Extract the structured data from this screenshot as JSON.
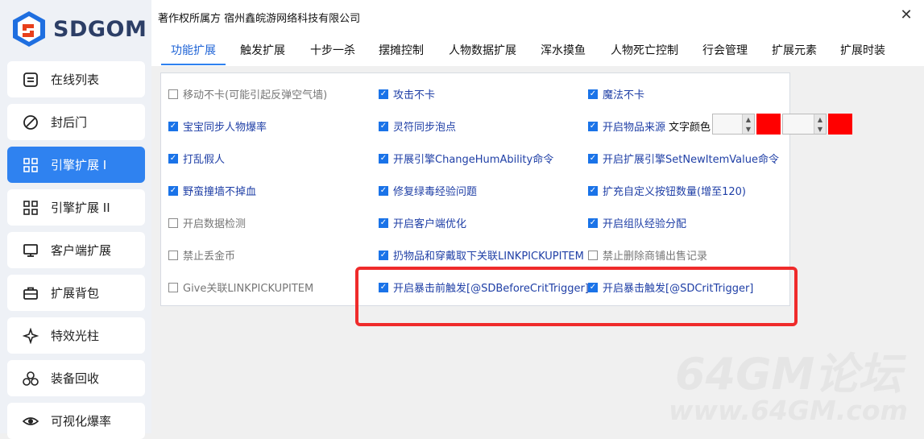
{
  "logo": {
    "text": "SDGOM"
  },
  "sidebar": {
    "items": [
      {
        "label": "在线列表",
        "icon": "list-icon"
      },
      {
        "label": "封后门",
        "icon": "block-icon"
      },
      {
        "label": "引擎扩展 I",
        "icon": "grid-icon",
        "active": true
      },
      {
        "label": "引擎扩展 II",
        "icon": "grid-icon"
      },
      {
        "label": "客户端扩展",
        "icon": "monitor-icon"
      },
      {
        "label": "扩展背包",
        "icon": "briefcase-icon"
      },
      {
        "label": "特效光柱",
        "icon": "sparkle-icon"
      },
      {
        "label": "装备回收",
        "icon": "recycle-icon"
      },
      {
        "label": "可视化爆率",
        "icon": "eye-icon"
      }
    ]
  },
  "window": {
    "title": "著作权所属方 宿州鑫皖游网络科技有限公司",
    "close": "✕"
  },
  "tabs": [
    {
      "label": "功能扩展",
      "active": true
    },
    {
      "label": "触发扩展"
    },
    {
      "label": "十步一杀"
    },
    {
      "label": "摆摊控制"
    },
    {
      "label": "人物数据扩展"
    },
    {
      "label": "浑水摸鱼"
    },
    {
      "label": "人物死亡控制"
    },
    {
      "label": "行会管理"
    },
    {
      "label": "扩展元素"
    },
    {
      "label": "扩展时装"
    }
  ],
  "options": {
    "col1": [
      {
        "label": "移动不卡(可能引起反弹空气墙)",
        "checked": false
      },
      {
        "label": "宝宝同步人物爆率",
        "checked": true
      },
      {
        "label": "打乱假人",
        "checked": true
      },
      {
        "label": "野蛮撞墙不掉血",
        "checked": true
      },
      {
        "label": "开启数据检测",
        "checked": false
      },
      {
        "label": "禁止丢金币",
        "checked": false
      },
      {
        "label": "Give关联LINKPICKUPITEM",
        "checked": false
      }
    ],
    "col2": [
      {
        "label": "攻击不卡",
        "checked": true
      },
      {
        "label": "灵符同步泡点",
        "checked": true
      },
      {
        "label": "开展引擎ChangeHumAbility命令",
        "checked": true
      },
      {
        "label": "修复绿毒经验问题",
        "checked": true
      },
      {
        "label": "开启客户端优化",
        "checked": true
      },
      {
        "label": "扔物品和穿戴取下关联LINKPICKUPITEM",
        "checked": true
      },
      {
        "label": "开启暴击前触发[@SDBeforeCritTrigger]",
        "checked": true
      }
    ],
    "col3": [
      {
        "label": "魔法不卡",
        "checked": true
      },
      {
        "label": "开启物品来源",
        "checked": true
      },
      {
        "label": "开启扩展引擎SetNewItemValue命令",
        "checked": true
      },
      {
        "label": "扩充自定义按钮数量(增至120)",
        "checked": true
      },
      {
        "label": "开启组队经验分配",
        "checked": true
      },
      {
        "label": "禁止删除商铺出售记录",
        "checked": false
      },
      {
        "label": "开启暴击触发[@SDCritTrigger]",
        "checked": true
      }
    ]
  },
  "text_color": {
    "label": "文字颜色",
    "swatch1": "#ff0000",
    "swatch2": "#ff0000"
  },
  "colors": {
    "accent": "#2f82f0",
    "highlight": "#ef2b2b",
    "checked_text": "#1f3fa6"
  },
  "watermark": {
    "line1": "64GM论坛",
    "line2": "www.64GM.com"
  }
}
